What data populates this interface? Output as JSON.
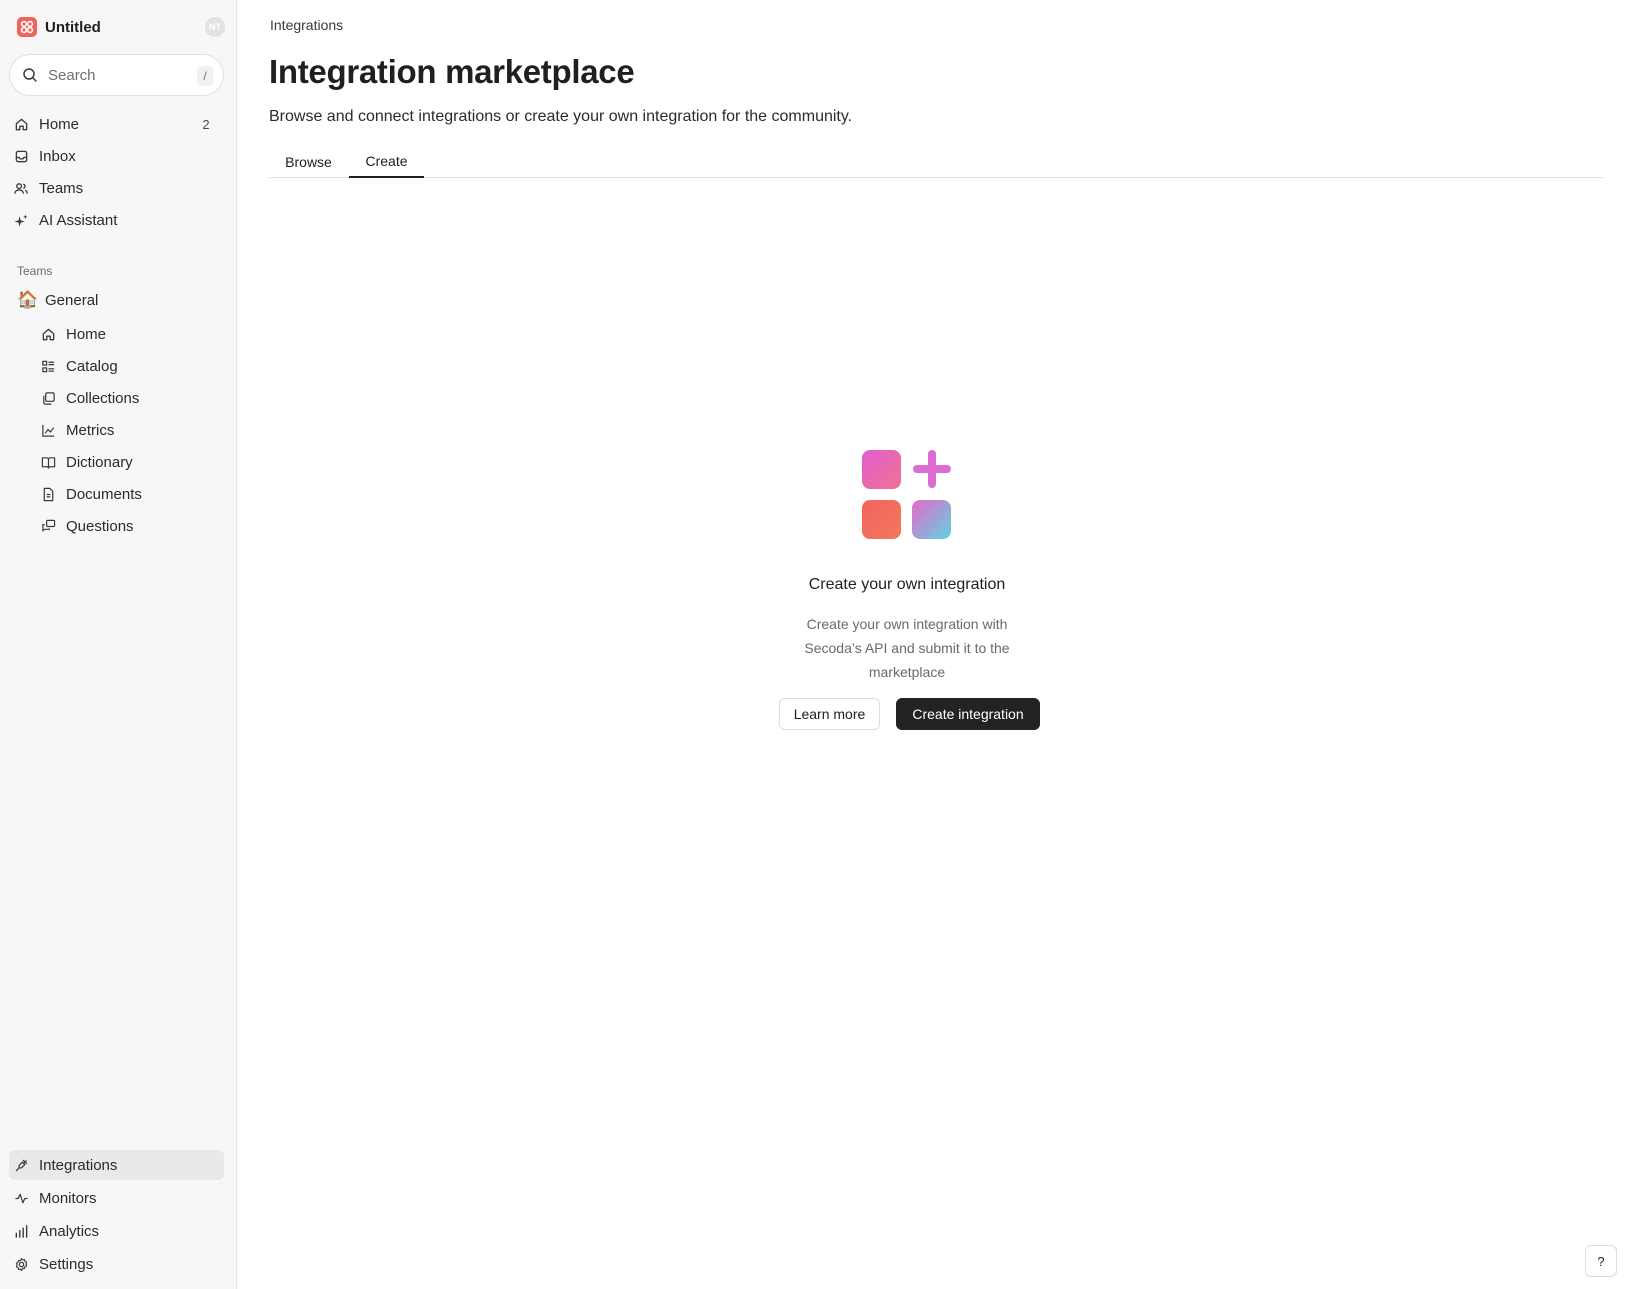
{
  "workspace": {
    "name": "Untitled",
    "avatar_initials": "NT",
    "logo_color": "#f0635a"
  },
  "search": {
    "placeholder": "Search",
    "shortcut": "/"
  },
  "nav": [
    {
      "label": "Home",
      "icon": "home-icon",
      "badge": "2"
    },
    {
      "label": "Inbox",
      "icon": "inbox-icon"
    },
    {
      "label": "Teams",
      "icon": "users-icon"
    },
    {
      "label": "AI Assistant",
      "icon": "sparkles-icon"
    }
  ],
  "teams_section": {
    "label": "Teams",
    "team": {
      "emoji": "🏠",
      "name": "General"
    },
    "items": [
      {
        "label": "Home",
        "icon": "home-icon"
      },
      {
        "label": "Catalog",
        "icon": "catalog-icon"
      },
      {
        "label": "Collections",
        "icon": "collections-icon"
      },
      {
        "label": "Metrics",
        "icon": "chart-icon"
      },
      {
        "label": "Dictionary",
        "icon": "book-icon"
      },
      {
        "label": "Documents",
        "icon": "document-icon"
      },
      {
        "label": "Questions",
        "icon": "questions-icon"
      }
    ]
  },
  "bottom_nav": [
    {
      "label": "Integrations",
      "icon": "plug-icon",
      "active": true
    },
    {
      "label": "Monitors",
      "icon": "pulse-icon"
    },
    {
      "label": "Analytics",
      "icon": "bar-chart-icon"
    },
    {
      "label": "Settings",
      "icon": "gear-icon"
    }
  ],
  "main": {
    "breadcrumb": "Integrations",
    "title": "Integration marketplace",
    "subtitle": "Browse and connect integrations or create your own integration for the community.",
    "tabs": [
      {
        "label": "Browse",
        "active": false
      },
      {
        "label": "Create",
        "active": true
      }
    ],
    "empty_state": {
      "title": "Create your own integration",
      "description": "Create your own integration with Secoda’s API and submit it to the marketplace",
      "secondary_button": "Learn more",
      "primary_button": "Create integration"
    },
    "help_button": "?"
  },
  "colors": {
    "accent_dark": "#232323",
    "sidebar_bg": "#f7f7f7",
    "active_item_bg": "#e9e9e9",
    "illustration_pink": "#e364c6",
    "illustration_coral": "#f2664f",
    "illustration_teal": "#6ccde0"
  }
}
